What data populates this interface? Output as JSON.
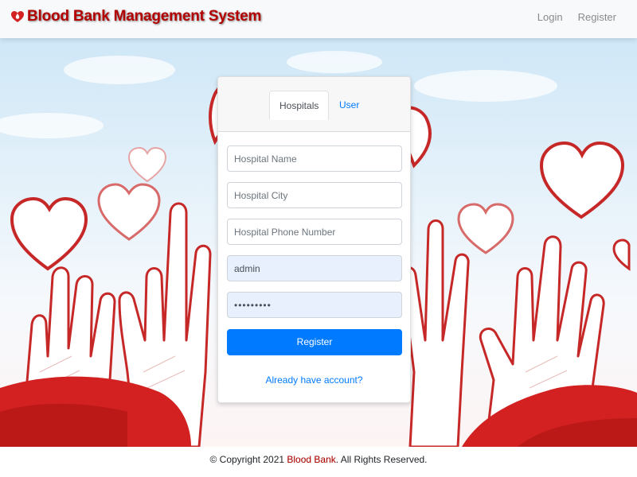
{
  "navbar": {
    "brand": "Blood Bank Management System",
    "links": [
      {
        "label": "Login"
      },
      {
        "label": "Register"
      }
    ]
  },
  "card": {
    "tabs": [
      {
        "label": "Hospitals",
        "active": true
      },
      {
        "label": "User",
        "active": false
      }
    ],
    "fields": {
      "hospital_name": {
        "placeholder": "Hospital Name",
        "value": ""
      },
      "hospital_city": {
        "placeholder": "Hospital City",
        "value": ""
      },
      "hospital_phone": {
        "placeholder": "Hospital Phone Number",
        "value": ""
      },
      "username": {
        "placeholder": "",
        "value": "admin"
      },
      "password": {
        "placeholder": "",
        "value": "•••••••••"
      }
    },
    "submit_label": "Register",
    "login_link": "Already have account?"
  },
  "footer": {
    "prefix": "© Copyright 2021 ",
    "brand": "Blood Bank",
    "suffix": ". All Rights Reserved."
  },
  "colors": {
    "brand": "#b30000",
    "primary": "#007bff",
    "autofill": "#e8f0fe"
  },
  "icons": {
    "brand_logo": "blood-drop-heart-icon"
  }
}
